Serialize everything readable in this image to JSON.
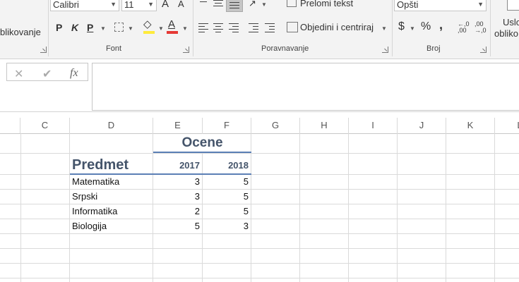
{
  "ribbon": {
    "left_partial_label": "blikovanje",
    "font": {
      "name": "Calibri",
      "size": "11",
      "group_label": "Font",
      "bold": "P",
      "italic": "K",
      "underline": "P",
      "font_color_glyph": "A",
      "grow_glyph": "A",
      "shrink_glyph": "A"
    },
    "alignment": {
      "wrap_text": "Prelomi tekst",
      "merge_center": "Objedini i centriraj",
      "group_label": "Poravnavanje"
    },
    "number": {
      "format": "Opšti",
      "currency": "$",
      "percent": "%",
      "comma": ",",
      "increase_decimal": "←,0\n,00",
      "decrease_decimal": ",00\n→,0",
      "group_label": "Broj"
    },
    "conditional": {
      "line1": "Uslo",
      "line2": "obliko"
    },
    "colors": {
      "fill_swatch": "#ffeb3b",
      "font_swatch": "#e53935",
      "selected_button": "#c5c5c5"
    }
  },
  "formula_bar": {
    "cancel_icon": "✕",
    "enter_icon": "✔",
    "fx_label": "fx",
    "content": ""
  },
  "columns": [
    "C",
    "D",
    "E",
    "F",
    "G",
    "H",
    "I",
    "J",
    "K",
    "L"
  ],
  "sheet": {
    "header_title": "Ocene",
    "subject_header": "Predmet",
    "years": [
      "2017",
      "2018"
    ],
    "rows": [
      {
        "subject": "Matematika",
        "y2017": "3",
        "y2018": "5"
      },
      {
        "subject": "Srpski",
        "y2017": "3",
        "y2018": "5"
      },
      {
        "subject": "Informatika",
        "y2017": "2",
        "y2018": "5"
      },
      {
        "subject": "Biologija",
        "y2017": "5",
        "y2018": "3"
      }
    ],
    "heading_color": "#44546a",
    "accent_border": "#5b7fb5"
  }
}
